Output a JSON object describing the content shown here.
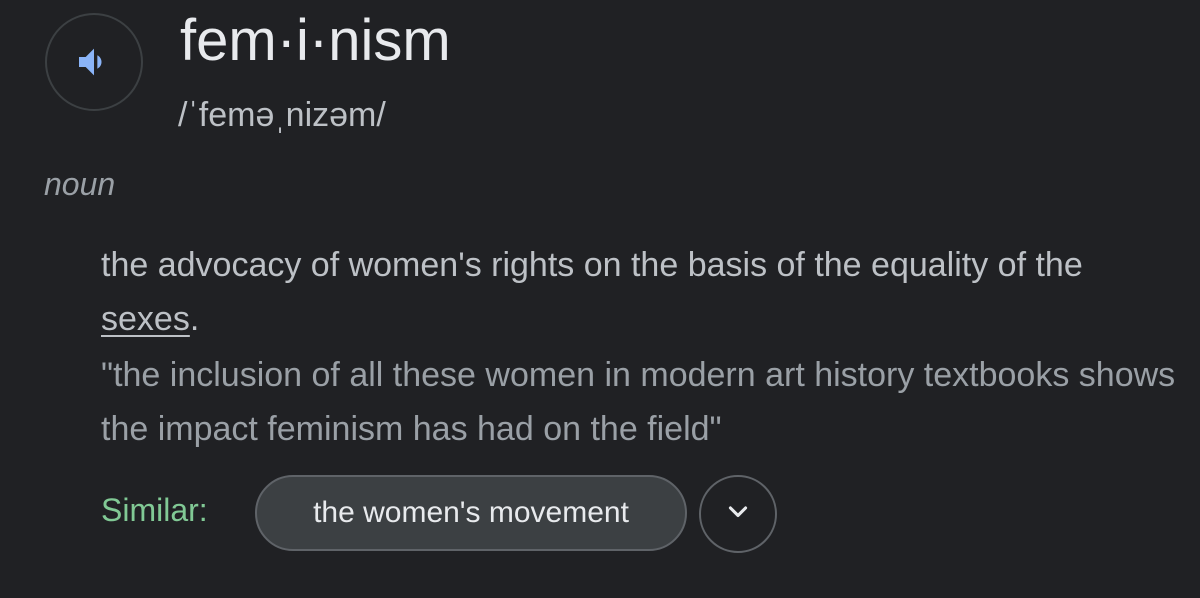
{
  "entry": {
    "word": "fem·i·nism",
    "phonetic": "/ˈfeməˌnizəm/",
    "part_of_speech": "noun",
    "audio_icon": "speaker-icon",
    "accent_color": "#8ab4f8"
  },
  "sense": {
    "definition_before_link": "the advocacy of women's rights on the basis of the equality of the ",
    "definition_link": "sexes",
    "definition_after_link": ".",
    "example": "\"the inclusion of all these women in modern art history textbooks shows the impact feminism has had on the field\""
  },
  "similar": {
    "label": "Similar:",
    "label_color": "#81c995",
    "chips": [
      "the women's movement"
    ],
    "expand_icon": "chevron-down-icon"
  }
}
